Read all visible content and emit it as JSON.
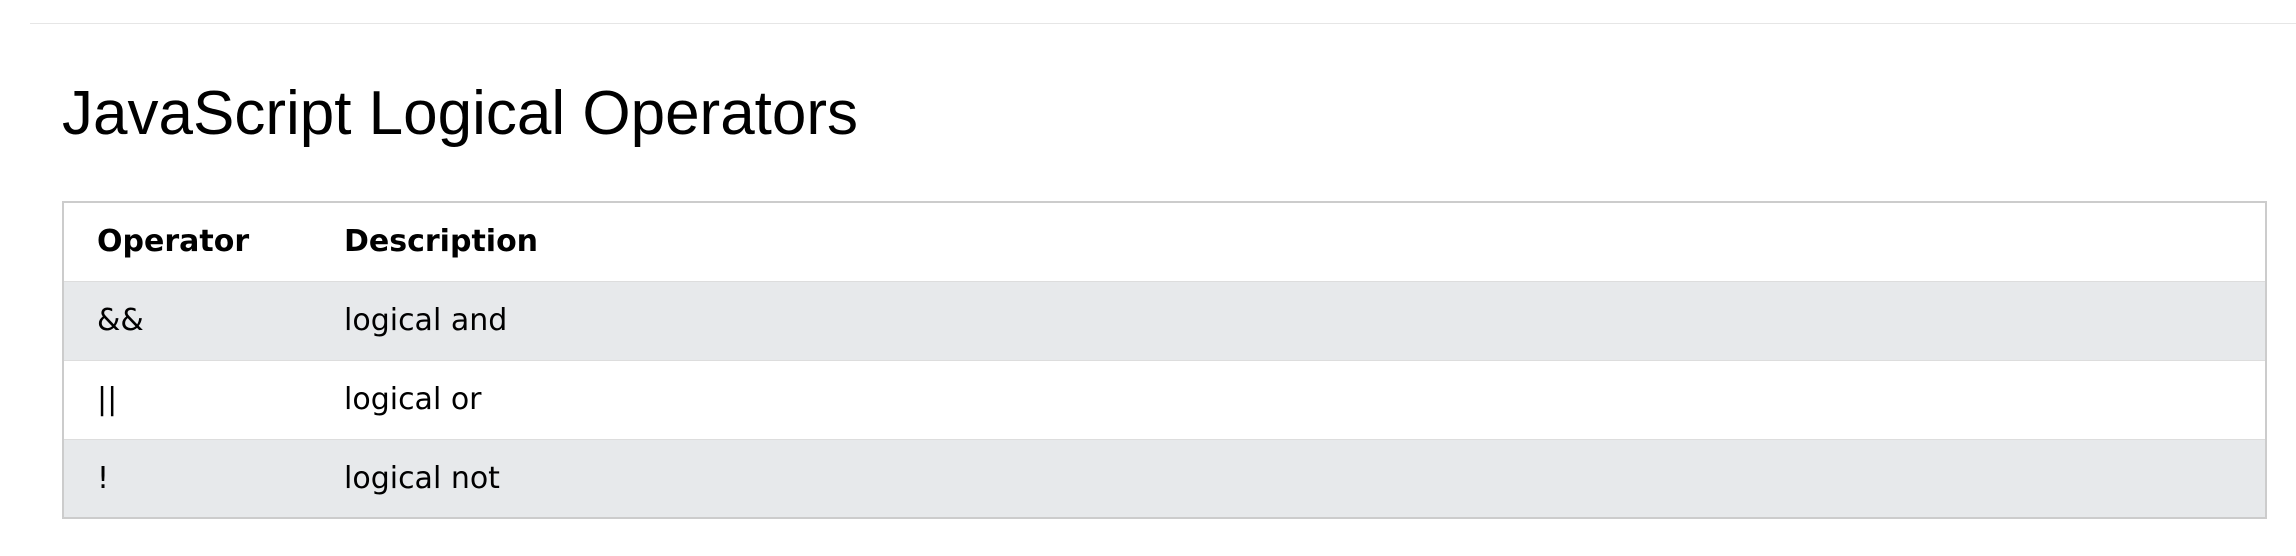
{
  "page": {
    "title": "JavaScript Logical Operators"
  },
  "table": {
    "headers": {
      "operator": "Operator",
      "description": "Description"
    },
    "rows": [
      {
        "operator": "&&",
        "description": "logical and"
      },
      {
        "operator": "||",
        "description": "logical or"
      },
      {
        "operator": "!",
        "description": "logical not"
      }
    ]
  },
  "colors": {
    "text": "#000000",
    "background": "#ffffff",
    "row_shade": "#e7e9eb",
    "table_border": "#cccccc",
    "row_divider": "#dddddd"
  }
}
